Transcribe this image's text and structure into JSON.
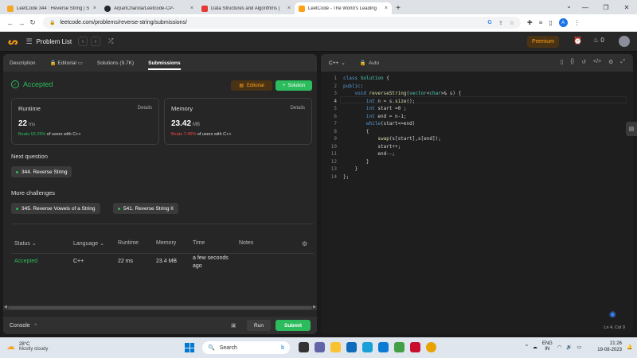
{
  "browser": {
    "tabs": [
      {
        "title": "LeetCode 344 : Reverse String | S",
        "favicon_color": "#f5a623",
        "active": false
      },
      {
        "title": "ArpanCharola/Leetcode-CP-",
        "favicon_color": "#24292f",
        "active": false
      },
      {
        "title": "Data Structures and Algorithms |",
        "favicon_color": "#e53935",
        "active": false
      },
      {
        "title": "LeetCode - The World's Leading",
        "favicon_color": "#ffa116",
        "active": true
      }
    ],
    "url": "leetcode.com/problems/reverse-string/submissions/",
    "profile_initial": "A"
  },
  "lc_nav": {
    "problem_list": "Problem List",
    "premium": "Premium",
    "streak": "0"
  },
  "left_tabs": [
    {
      "label": "Description"
    },
    {
      "label": "Editorial"
    },
    {
      "label": "Solutions (9.7K)"
    },
    {
      "label": "Submissions"
    }
  ],
  "result": {
    "status": "Accepted",
    "editorial_btn": "Editorial",
    "solution_btn": "Solution"
  },
  "runtime_card": {
    "label": "Runtime",
    "details": "Details",
    "value": "22",
    "unit": "ms",
    "beats_prefix": "Beats",
    "beats_pct": "53.25%",
    "beats_suffix": "of users with C++"
  },
  "memory_card": {
    "label": "Memory",
    "details": "Details",
    "value": "23.42",
    "unit": "MB",
    "beats_prefix": "Beats",
    "beats_pct": "7.40%",
    "beats_suffix": "of users with C++"
  },
  "next_question": {
    "title": "Next question",
    "item": "344. Reverse String"
  },
  "more_challenges": {
    "title": "More challenges",
    "items": [
      "345. Reverse Vowels of a String",
      "541. Reverse String II"
    ]
  },
  "table": {
    "headers": [
      "Status",
      "Language",
      "Runtime",
      "Memory",
      "Time",
      "Notes"
    ],
    "row": {
      "status": "Accepted",
      "language": "C++",
      "runtime": "22 ms",
      "memory": "23.4 MB",
      "time_line1": "a few seconds",
      "time_line2": "ago",
      "notes": ""
    }
  },
  "console": {
    "label": "Console",
    "run": "Run",
    "submit": "Submit"
  },
  "editor": {
    "language": "C++",
    "mode": "Auto",
    "status": "Ln 4, Col 9",
    "current_line": 4,
    "lines": [
      "class Solution {",
      "public:",
      "    void reverseString(vector<char>& s) {",
      "        int n = s.size();",
      "        int start =0 ;",
      "        int end = n-1;",
      "        while(start<=end)",
      "        {",
      "            swap(s[start],s[end]);",
      "            start++;",
      "            end--;",
      "        }",
      "    }",
      "};"
    ]
  },
  "taskbar": {
    "temp": "28°C",
    "weather": "Mostly cloudy",
    "search": "Search",
    "lang_top": "ENG",
    "lang_bottom": "IN",
    "time": "21:26",
    "date": "19-08-2023"
  },
  "colors": {
    "accent_green": "#2cbb5d",
    "accent_orange": "#ffa116",
    "bad_red": "#ef4743"
  }
}
